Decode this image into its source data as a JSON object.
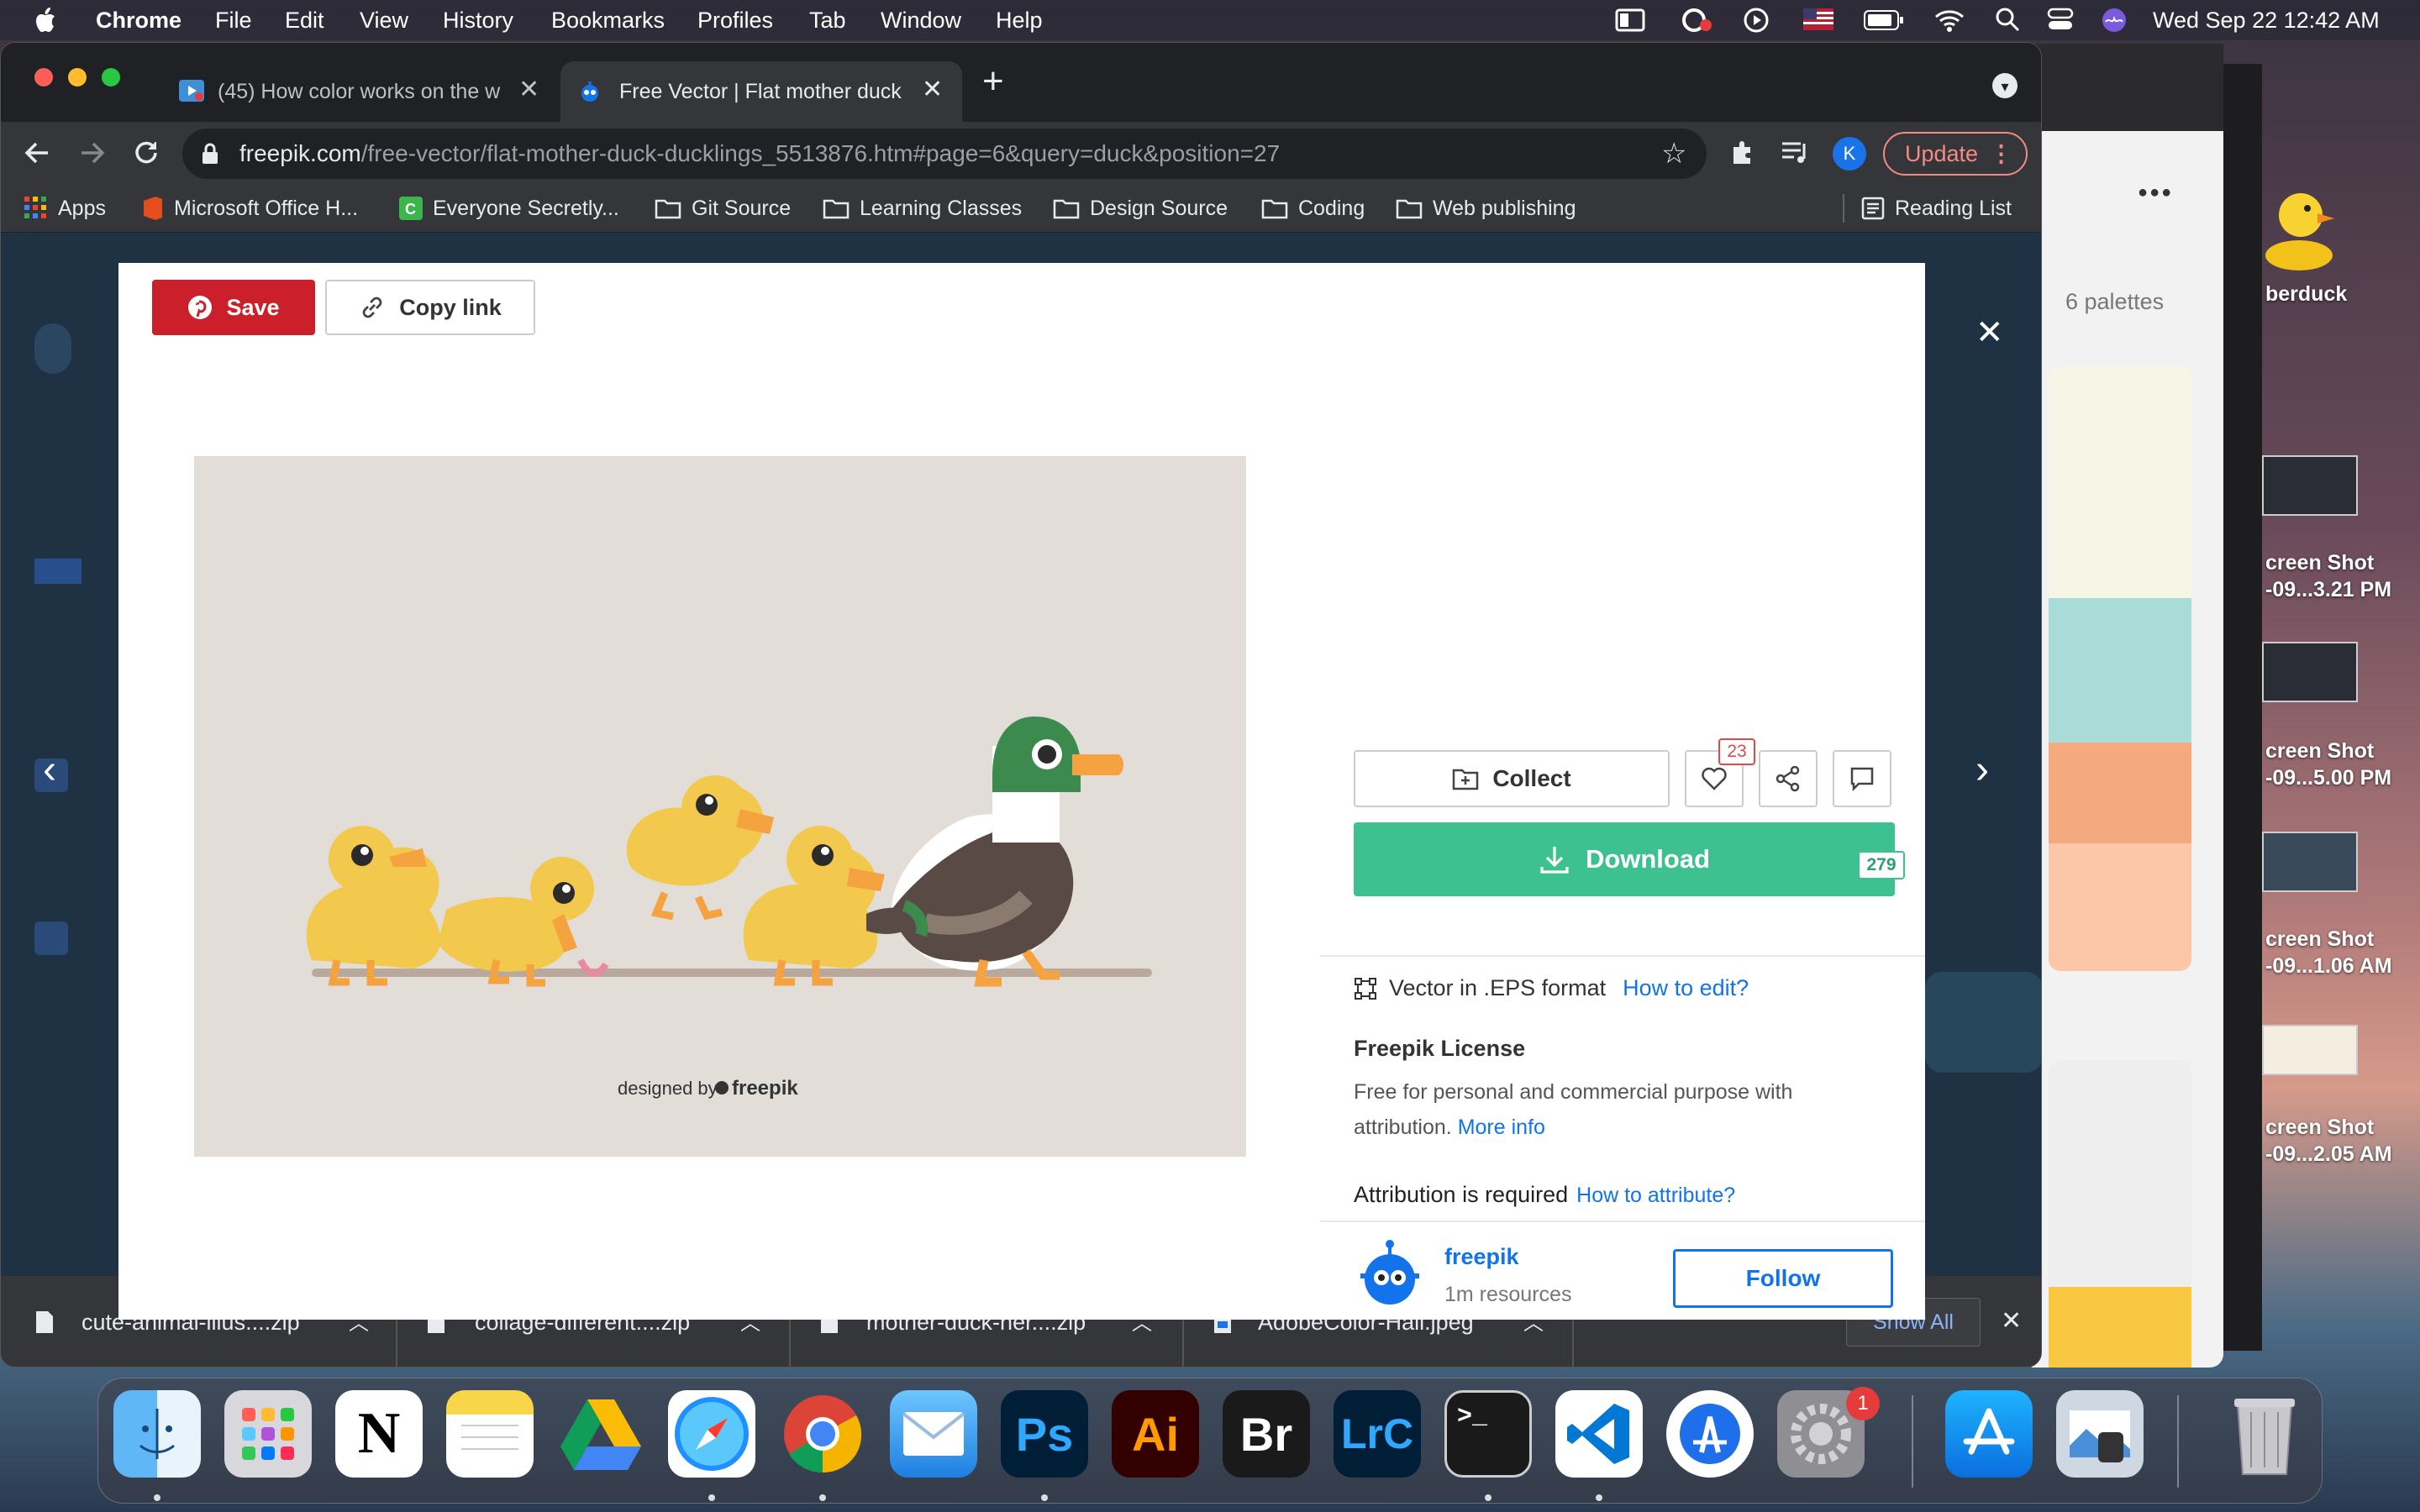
{
  "menubar": {
    "apple_icon": "apple-icon",
    "items": [
      "Chrome",
      "File",
      "Edit",
      "View",
      "History",
      "Bookmarks",
      "Profiles",
      "Tab",
      "Window",
      "Help"
    ],
    "datetime": "Wed Sep 22  12:42 AM"
  },
  "desktop": {
    "rubberduck_label": "berduck",
    "screenshots": [
      {
        "line1": "creen Shot",
        "line2": "-09...3.21 PM"
      },
      {
        "line1": "creen Shot",
        "line2": "-09...5.00 PM"
      },
      {
        "line1": "creen Shot",
        "line2": "-09...1.06 AM"
      },
      {
        "line1": "creen Shot",
        "line2": "-09...2.05 AM"
      }
    ]
  },
  "bgwindow": {
    "palettes_label": "6 palettes",
    "swatches": [
      "#f7f5e6",
      "#a9dbd8",
      "#f5a97f",
      "#fcc7a8"
    ],
    "footer_swatch": "#f9c842"
  },
  "chrome": {
    "tabs": [
      {
        "title": "(45) How color works on the w",
        "icon": "youtube-icon"
      },
      {
        "title": "Free Vector | Flat mother duck",
        "icon": "freepik-icon"
      }
    ],
    "address": {
      "domain": "freepik.com",
      "path": "/free-vector/flat-mother-duck-ducklings_5513876.htm#page=6&query=duck&position=27"
    },
    "profile_initial": "K",
    "update_label": "Update",
    "bookmarks": [
      {
        "label": "Apps",
        "icon": "apps-grid-icon"
      },
      {
        "label": "Microsoft Office H...",
        "icon": "office-icon"
      },
      {
        "label": "Everyone Secretly...",
        "icon": "c-icon"
      },
      {
        "label": "Git Source",
        "icon": "folder-icon"
      },
      {
        "label": "Learning Classes",
        "icon": "folder-icon"
      },
      {
        "label": "Design Source",
        "icon": "folder-icon"
      },
      {
        "label": "Coding",
        "icon": "folder-icon"
      },
      {
        "label": "Web publishing",
        "icon": "folder-icon"
      }
    ],
    "reading_list": "Reading List"
  },
  "modal": {
    "save_label": "Save",
    "copy_link_label": "Copy link",
    "image_credit_prefix": "designed by",
    "image_credit_brand": "freepik",
    "collect_label": "Collect",
    "likes_count": "23",
    "download_label": "Download",
    "download_count": "279",
    "format_text": "Vector in .EPS format",
    "how_to_edit": "How to edit?",
    "license_title": "Freepik License",
    "license_text": "Free for personal and commercial purpose with attribution.",
    "more_info": "More info",
    "attribution_text": "Attribution is required",
    "how_to_attribute": "How to attribute?",
    "author_name": "freepik",
    "author_resources": "1m resources",
    "follow_label": "Follow",
    "colors": {
      "save": "#cc1f2c",
      "download": "#3dc190",
      "link": "#1273eb",
      "duck_yellow": "#f2c94c",
      "mallard_green": "#3d8a4e",
      "beak_orange": "#f5a340"
    }
  },
  "downloads": {
    "items": [
      "cute-animal-illus....zip",
      "collage-different....zip",
      "mother-duck-her....zip",
      "AdobeColor-Hall.jpeg"
    ],
    "show_all": "Show All"
  },
  "dock": {
    "apps": [
      "Finder",
      "Launchpad",
      "Notion",
      "Notes",
      "Google Drive",
      "Safari",
      "Chrome",
      "Mail",
      "Photoshop",
      "Illustrator",
      "Bridge",
      "Lightroom Classic",
      "Terminal",
      "VS Code",
      "Xcode Instruments",
      "System Preferences",
      "App Store",
      "Preview",
      "Trash"
    ],
    "prefs_badge": "1",
    "abbr": {
      "ps": "Ps",
      "ai": "Ai",
      "br": "Br",
      "lrc": "LrC",
      "notion": "N"
    }
  }
}
